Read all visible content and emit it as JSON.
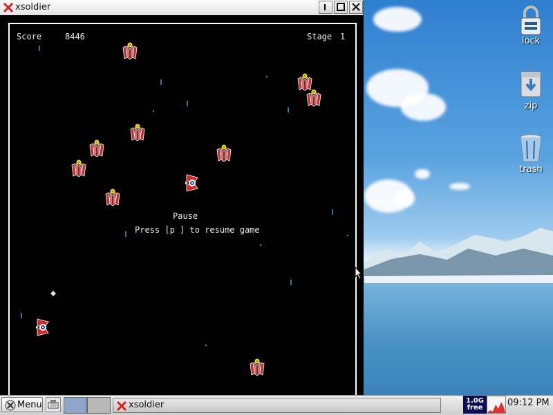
{
  "window": {
    "title": "xsoldier",
    "buttons": [
      "minimize",
      "maximize",
      "close"
    ]
  },
  "game": {
    "score_label": "Score",
    "score_value": "8446",
    "stage_label": "Stage",
    "stage_value": "1",
    "pause_title": "Pause",
    "pause_hint": "Press [p ] to resume game"
  },
  "desktop": {
    "icons": [
      {
        "label": "lock",
        "icon": "padlock-icon"
      },
      {
        "label": "zip",
        "icon": "archive-icon"
      },
      {
        "label": "trash",
        "icon": "trash-icon"
      }
    ]
  },
  "taskbar": {
    "menu_label": "Menu",
    "task_label": "xsoldier",
    "disk_size": "1.0G",
    "disk_state": "free",
    "clock": "09:12 PM"
  },
  "colors": {
    "enemy_red": "#c0302a",
    "enemy_yellow": "#ffd23a",
    "shot": "#2a7a95",
    "title_x": "#d02020"
  }
}
